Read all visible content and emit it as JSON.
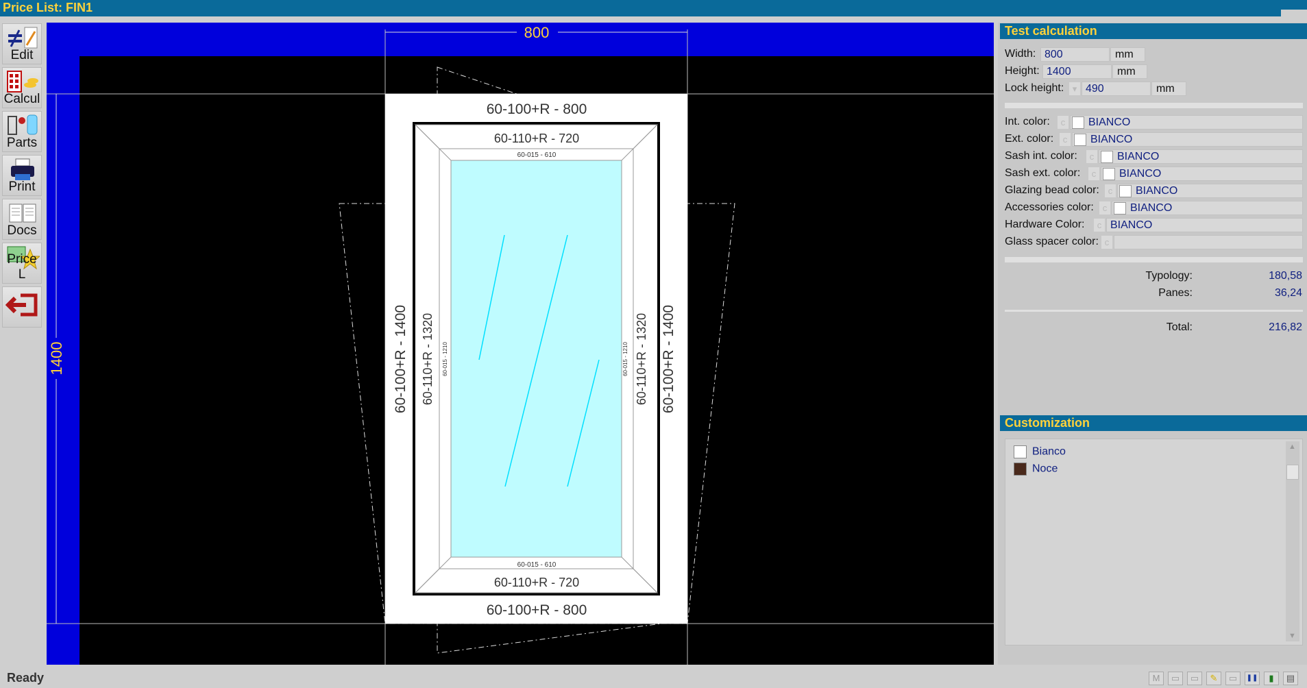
{
  "window": {
    "title": "Price List: FIN1"
  },
  "toolbar": {
    "items": [
      {
        "label": "Edit",
        "icon": "edit-icon"
      },
      {
        "label": "Calcul",
        "icon": "calculator-icon"
      },
      {
        "label": "Parts",
        "icon": "parts-icon"
      },
      {
        "label": "Print",
        "icon": "printer-icon"
      },
      {
        "label": "Docs",
        "icon": "documents-icon"
      },
      {
        "label": "Price L",
        "icon": "price-list-icon"
      },
      {
        "label": "",
        "icon": "exit-icon"
      }
    ]
  },
  "drawing": {
    "overall_width": "800",
    "overall_height": "1400",
    "frame_top": "60-100+R - 800",
    "frame_bottom": "60-100+R - 800",
    "frame_left": "60-100+R - 1400",
    "frame_right": "60-100+R - 1400",
    "sash_top": "60-110+R - 720",
    "sash_bottom": "60-110+R - 720",
    "sash_left": "60-110+R - 1320",
    "sash_right": "60-110+R - 1320",
    "bead_top": "60-015 - 610",
    "bead_bottom": "60-015 - 610",
    "bead_left": "60-015 - 1210",
    "bead_right": "60-015 - 1210"
  },
  "test_calculation": {
    "header": "Test calculation",
    "width_label": "Width:",
    "width_value": "800",
    "width_unit": "mm",
    "height_label": "Height:",
    "height_value": "1400",
    "height_unit": "mm",
    "lock_label": "Lock height:",
    "lock_value": "490",
    "lock_unit": "mm",
    "colors": [
      {
        "label": "Int. color:",
        "value": "BIANCO"
      },
      {
        "label": "Ext. color:",
        "value": "BIANCO"
      },
      {
        "label": "Sash int. color:",
        "value": "BIANCO"
      },
      {
        "label": "Sash ext. color:",
        "value": "BIANCO"
      },
      {
        "label": "Glazing bead color:",
        "value": "BIANCO"
      },
      {
        "label": "Accessories color:",
        "value": "BIANCO"
      },
      {
        "label": "Hardware Color:",
        "value": "BIANCO"
      },
      {
        "label": "Glass spacer color:",
        "value": ""
      }
    ],
    "color_button_glyph": "c",
    "typology_label": "Typology:",
    "typology_value": "180,58",
    "panes_label": "Panes:",
    "panes_value": "36,24",
    "total_label": "Total:",
    "total_value": "216,82"
  },
  "customization": {
    "header": "Customization",
    "items": [
      {
        "label": "Bianco",
        "color": "#ffffff"
      },
      {
        "label": "Noce",
        "color": "#4a2a1c"
      }
    ]
  },
  "status": {
    "text": "Ready"
  },
  "status_icons": [
    {
      "name": "m-status-icon",
      "glyph": "M"
    },
    {
      "name": "monitor-icon",
      "glyph": "▭"
    },
    {
      "name": "window-icon",
      "glyph": "▭"
    },
    {
      "name": "ruler-icon",
      "glyph": "✎"
    },
    {
      "name": "display-icon",
      "glyph": "▭"
    },
    {
      "name": "pause-icon",
      "glyph": "❚❚"
    },
    {
      "name": "door-icon",
      "glyph": "▮"
    },
    {
      "name": "calculator-small-icon",
      "glyph": "▤"
    }
  ]
}
